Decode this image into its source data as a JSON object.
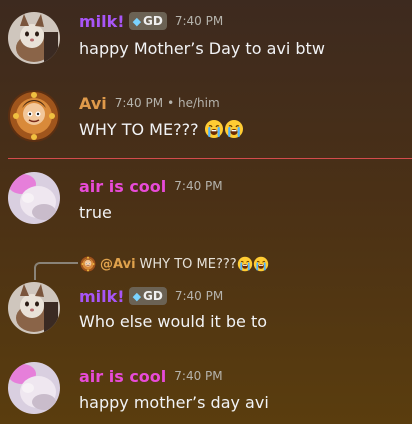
{
  "messages": [
    {
      "author": "milk!",
      "author_color": "#a855f7",
      "tag": "GD",
      "timestamp": "7:40 PM",
      "text": "happy Mother’s Day to avi btw"
    },
    {
      "author": "Avi",
      "author_color": "#e09a4a",
      "timestamp": "7:40 PM",
      "pronouns": "• he/him",
      "text": "WHY TO ME???",
      "emoji": [
        "loudly-crying-face",
        "loudly-crying-face"
      ]
    },
    {
      "author": "air is cool",
      "author_color": "#e84bd8",
      "timestamp": "7:40 PM",
      "text": "true"
    },
    {
      "reply_to": {
        "author": "@Avi",
        "text": "WHY TO ME???"
      },
      "author": "milk!",
      "author_color": "#a855f7",
      "tag": "GD",
      "timestamp": "7:40 PM",
      "text": "Who else would it be to"
    },
    {
      "author": "air is cool",
      "author_color": "#e84bd8",
      "timestamp": "7:40 PM",
      "text": "happy mother’s day avi"
    }
  ],
  "colors": {
    "divider": "#d44c4c",
    "reply_author": "#e0a24c"
  }
}
